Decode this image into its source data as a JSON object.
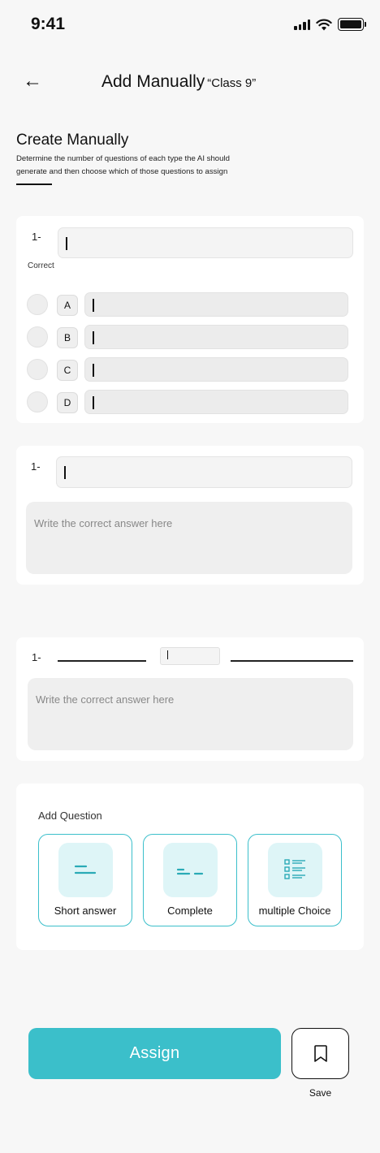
{
  "status_bar": {
    "time": "9:41"
  },
  "header": {
    "title": "Add Manually",
    "subtitle": "“Class 9”",
    "back_icon": "arrow-left-icon"
  },
  "intro": {
    "title": "Create Manually",
    "description_line1": "Determine the number of questions of each type the AI should",
    "description_line2": "generate and then choose which of those questions to assign"
  },
  "mc_question": {
    "number": "1-",
    "correct_label": "Correct",
    "options": [
      {
        "letter": "A"
      },
      {
        "letter": "B"
      },
      {
        "letter": "C"
      },
      {
        "letter": "D"
      }
    ]
  },
  "short_question": {
    "number": "1-",
    "answer_placeholder": "Write the correct answer here"
  },
  "complete_question": {
    "number": "1-",
    "answer_placeholder": "Write the correct answer here"
  },
  "add_question": {
    "title": "Add Question",
    "types": [
      {
        "label": "Short answer",
        "icon": "short-answer-icon"
      },
      {
        "label": "Complete",
        "icon": "complete-icon"
      },
      {
        "label": "multiple Choice",
        "icon": "multiple-choice-icon"
      }
    ]
  },
  "actions": {
    "assign_label": "Assign",
    "save_label": "Save",
    "save_icon": "bookmark-icon"
  },
  "colors": {
    "accent": "#3bbfca",
    "accent_light": "#def5f7",
    "card_bg": "#ffffff",
    "page_bg": "#f7f7f7"
  }
}
